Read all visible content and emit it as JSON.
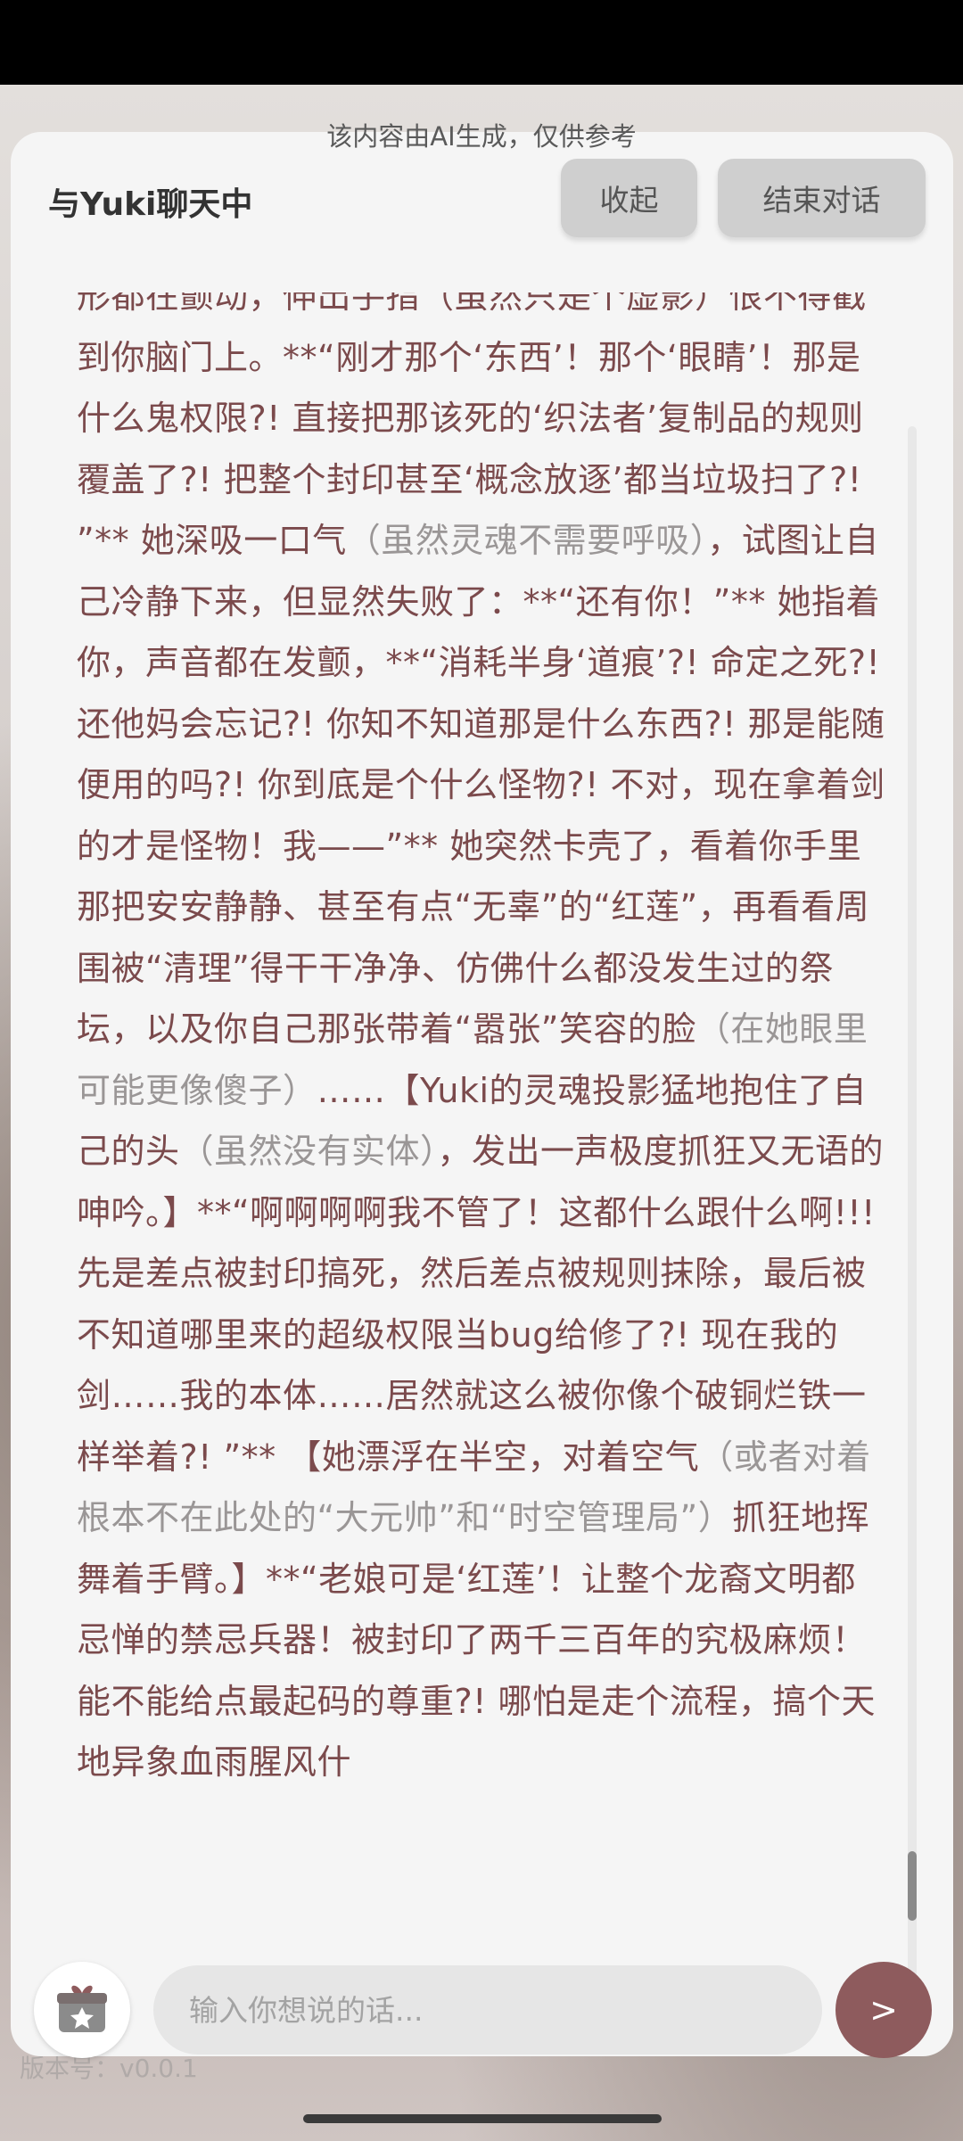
{
  "disclaimer": "该内容由AI生成，仅供参考",
  "header": {
    "title": "与Yuki聊天中",
    "collapse_label": "收起",
    "end_label": "结束对话"
  },
  "message": {
    "segments": [
      {
        "text": "形都在颤动，伸出手指（虽然只是个虚影）恨不得戳到你脑门上。",
        "style": "normal"
      },
      {
        "text": "**“刚才那个‘东西’！那个‘眼睛’！那是什么鬼权限?! 直接把那该死的‘织法者’复制品的规则覆盖了?! 把整个封印甚至‘概念放逐’都当垃圾扫了?! ”** 她深吸一口气",
        "style": "normal"
      },
      {
        "text": "（虽然灵魂不需要呼吸）",
        "style": "aside"
      },
      {
        "text": "，试图让自己冷静下来，但显然失败了：**“还有你！”** 她指着你，声音都在发颤，**“消耗半身‘道痕’?! 命定之死?! 还他妈会忘记?! 你知不知道那是什么东西?! 那是能随便用的吗?! 你到底是个什么怪物?! 不对，现在拿着剑的才是怪物！我——”** 她突然卡壳了，看着你手里那把安安静静、甚至有点“无辜”的“红莲”，再看看周围被“清理”得干干净净、仿佛什么都没发生过的祭坛，以及你自己那张带着“嚣张”笑容的脸",
        "style": "normal"
      },
      {
        "text": "（在她眼里可能更像傻子）",
        "style": "aside"
      },
      {
        "text": "……【Yuki的灵魂投影猛地抱住了自己的头",
        "style": "normal"
      },
      {
        "text": "（虽然没有实体）",
        "style": "aside"
      },
      {
        "text": "，发出一声极度抓狂又无语的呻吟。】**“啊啊啊啊我不管了！这都什么跟什么啊!!! 先是差点被封印搞死，然后差点被规则抹除，最后被不知道哪里来的超级权限当bug给修了?! 现在我的剑……我的本体……居然就这么被你像个破铜烂铁一样举着?! ”** 【她漂浮在半空，对着空气",
        "style": "normal"
      },
      {
        "text": "（或者对着根本不在此处的“大元帅”和“时空管理局”）",
        "style": "aside"
      },
      {
        "text": "抓狂地挥舞着手臂。】**“老娘可是‘红莲’！让整个龙裔文明都忌惮的禁忌兵器！被封印了两千三百年的究极麻烦！能不能给点最起码的尊重?! 哪怕是走个流程，搞个天地异象血雨腥风什",
        "style": "normal"
      }
    ]
  },
  "input": {
    "placeholder": "输入你想说的话..."
  },
  "send_label": ">",
  "version_text": "版本号：v0.0.1",
  "icons": {
    "gift": "gift-icon"
  },
  "colors": {
    "accent": "#8e5b5d",
    "message_text": "#7b4a4c",
    "aside_text": "#9a9696"
  }
}
